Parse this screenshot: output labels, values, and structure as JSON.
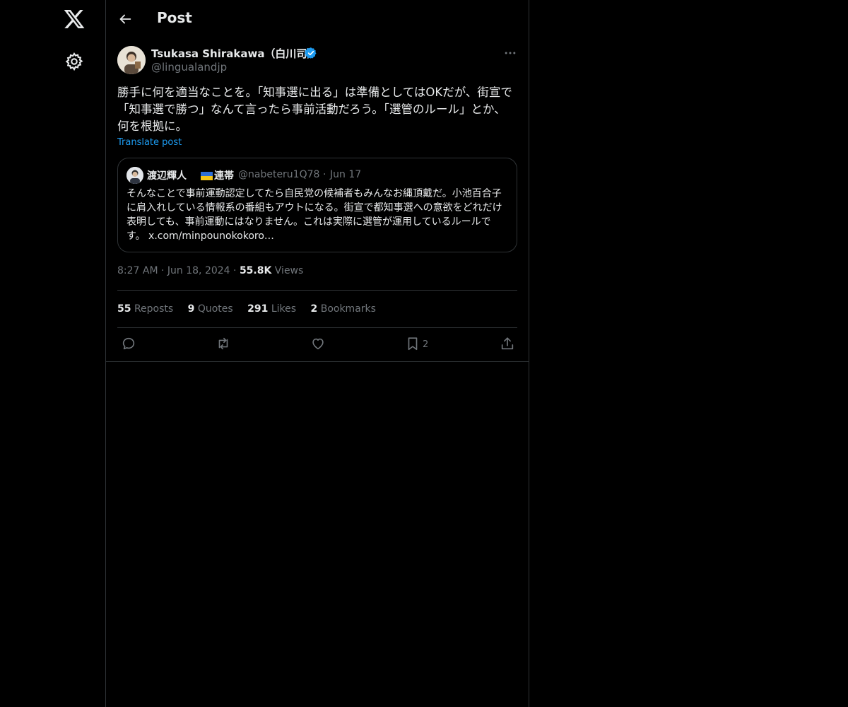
{
  "colors": {
    "background": "#000000",
    "text_primary": "#e7e9ea",
    "text_secondary": "#71767b",
    "accent": "#1d9bf0",
    "border": "#2f3336"
  },
  "nav": {
    "logo_icon": "x-logo-icon",
    "settings_icon": "gear-icon"
  },
  "header": {
    "title": "Post",
    "back_icon": "arrow-left-icon"
  },
  "post": {
    "author_name": "Tsukasa Shirakawa（白川司）",
    "author_handle": "@lingualandjp",
    "verified": true,
    "text": "勝手に何を適当なことを。「知事選に出る」は準備としてはOKだが、街宣で「知事選で勝つ」なんて言ったら事前活動だろう。「選管のルール」とか、何を根拠に。",
    "translate_label": "Translate post",
    "time": "8:27 AM",
    "date": "Jun 18, 2024",
    "views_count": "55.8K",
    "views_label": "Views"
  },
  "quote": {
    "author_name": "渡辺輝人",
    "author_name_suffix": "連帯",
    "flag": "ukraine-flag",
    "author_handle": "@nabeteru1Q78",
    "date": "Jun 17",
    "text": "そんなことで事前運動認定してたら自民党の候補者もみんなお縄頂戴だ。小池百合子に肩入れしている情報系の番組もアウトになる。街宣で都知事選への意欲をどれだけ表明しても、事前運動にはなりません。これは実際に選管が運用しているルールです。 x.com/minpounokokoro…"
  },
  "stats": {
    "reposts_count": "55",
    "reposts_label": "Reposts",
    "quotes_count": "9",
    "quotes_label": "Quotes",
    "likes_count": "291",
    "likes_label": "Likes",
    "bookmarks_count": "2",
    "bookmarks_label": "Bookmarks"
  },
  "actions": {
    "reply_icon": "reply-icon",
    "repost_icon": "repost-icon",
    "like_icon": "heart-icon",
    "bookmark_icon": "bookmark-icon",
    "bookmark_count": "2",
    "share_icon": "share-icon"
  }
}
